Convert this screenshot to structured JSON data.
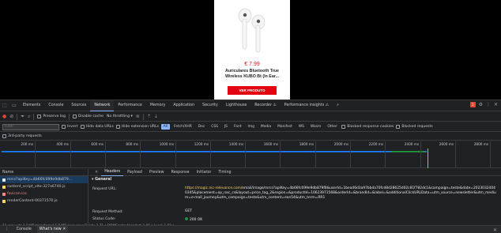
{
  "product": {
    "price": "€ 7.99",
    "name": "Auriculares Bluetooth True Wireless KUBO Bt (In Ear...",
    "button": "VER PRODUTO"
  },
  "devtools": {
    "panel_tabs": [
      "Elements",
      "Console",
      "Sources",
      "Network",
      "Performance",
      "Memory",
      "Application",
      "Security",
      "Lighthouse",
      "Recorder ⚠",
      "Performance insights ⚠"
    ],
    "active_panel": "Network",
    "issues_count": "1",
    "toolbar": {
      "preserve_log": "Preserve log",
      "disable_cache": "Disable cache",
      "throttling": "No throttling"
    },
    "filter": {
      "placeholder": "Filter",
      "invert": "Invert",
      "hide_data_urls": "Hide data URLs",
      "hide_extension_urls": "Hide extension URLs",
      "types": [
        "All",
        "Fetch/XHR",
        "Doc",
        "CSS",
        "JS",
        "Font",
        "Img",
        "Media",
        "Manifest",
        "WS",
        "Wasm",
        "Other"
      ],
      "active_type": "All",
      "blocked_cookies": "Blocked response cookies",
      "blocked_requests": "Blocked requests"
    },
    "third_party": "3rd-party requests",
    "timeline_ticks": [
      "200 ms",
      "400 ms",
      "600 ms",
      "800 ms",
      "1000 ms",
      "1200 ms",
      "1400 ms",
      "1600 ms",
      "1800 ms",
      "2000 ms",
      "2200 ms",
      "2400 ms",
      "2600 ms",
      "2800 ms"
    ],
    "requests": {
      "header": "Name",
      "items": [
        "mrcs?apiKey=4b66fc099e9db879...",
        "content_script_vite-327a6740.js",
        "favicon.ico",
        "renderContent-00371570.js"
      ]
    },
    "detail_tabs": [
      "Headers",
      "Payload",
      "Preview",
      "Response",
      "Initiator",
      "Timing"
    ],
    "active_detail_tab": "Headers",
    "general": {
      "title": "▾ General",
      "url_label": "Request URL:",
      "url_host": "https://magic.nic-relevance.com/",
      "url_rest": "email/image/mrcs?apiKey=4b66fc099e9db879f8&userId=1bea46d3a97bbda70fcd8d28625d02c81f782dc1&campaign=teste&date=20230324040345&placement=op_nac_cs&layout=price_tag_2&region=&productId=10623971568&orderId=&brandId=&label=&additionalClickURLData=utm_source=newsletter&utm_medium=e-mail_journey&utm_campaign=teste&utm_content=ean54&utm_term=RR1",
      "method_label": "Request Method:",
      "method_value": "GET",
      "status_label": "Status Code:",
      "status_value": "200 OK"
    },
    "status_bar": "11 requests   1.0 MB transferred   1.0 MB resources   Finish: 2.71 s   DOMContentLoaded: 1.06 s   Load: 1.50 s",
    "drawer_tabs": [
      "Console",
      "What's new ✕"
    ],
    "active_drawer_tab": "What's new ✕"
  }
}
